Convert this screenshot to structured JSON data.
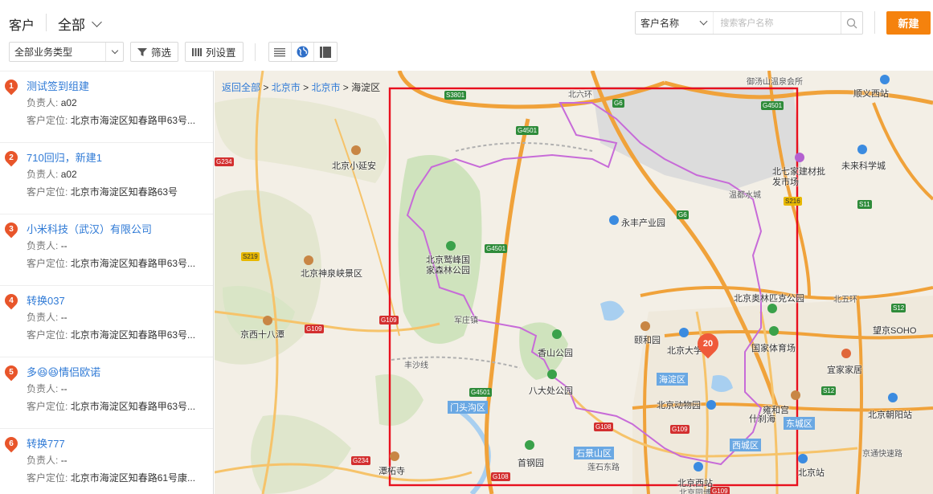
{
  "header": {
    "title": "客户",
    "scope_label": "全部",
    "search_field": "客户名称",
    "search_placeholder": "搜索客户名称",
    "new_button": "新建"
  },
  "toolbar": {
    "business_type": "全部业务类型",
    "filter_label": "筛选",
    "columns_label": "列设置"
  },
  "colors": {
    "accent": "#f5820d",
    "link": "#2f7ad6",
    "pin": "#e8552a",
    "selection": "#e8101e",
    "district_boundary": "#c76bd8"
  },
  "customers": [
    {
      "index": "1",
      "name": "测试签到组建",
      "owner_label": "负责人:",
      "owner": "a02",
      "loc_label": "客户定位:",
      "location": "北京市海淀区知春路甲63号..."
    },
    {
      "index": "2",
      "name": "710回归，新建1",
      "owner_label": "负责人:",
      "owner": "a02",
      "loc_label": "客户定位:",
      "location": "北京市海淀区知春路63号"
    },
    {
      "index": "3",
      "name": "小米科技（武汉）有限公司",
      "owner_label": "负责人:",
      "owner": "--",
      "loc_label": "客户定位:",
      "location": "北京市海淀区知春路甲63号..."
    },
    {
      "index": "4",
      "name": "转换037",
      "owner_label": "负责人:",
      "owner": "--",
      "loc_label": "客户定位:",
      "location": "北京市海淀区知春路甲63号..."
    },
    {
      "index": "5",
      "name": "多😆😆情侣欧诺",
      "owner_label": "负责人:",
      "owner": "--",
      "loc_label": "客户定位:",
      "location": "北京市海淀区知春路甲63号..."
    },
    {
      "index": "6",
      "name": "转换777",
      "owner_label": "负责人:",
      "owner": "--",
      "loc_label": "客户定位:",
      "location": "北京市海淀区知春路61号康..."
    }
  ],
  "map": {
    "breadcrumb": {
      "back": "返回全部",
      "sep": ">",
      "city1": "北京市",
      "city2": "北京市",
      "district": "海淀区"
    },
    "cluster_count": "20",
    "labels": [
      "北京小延安",
      "北京神泉峡景区",
      "京西十八潭",
      "北京鹫峰国家森林公园",
      "永丰产业园",
      "北七家建材批发市场",
      "温都水城",
      "御汤山温泉会所",
      "顺义西站",
      "未来科学城",
      "北京奥林匹克公园",
      "国家体育场",
      "望京SOHO",
      "宜家家居",
      "北京朝阳站",
      "颐和园",
      "北京大学",
      "香山公园",
      "八大处公园",
      "北京动物园",
      "什刹海",
      "雍和宫",
      "首钢园",
      "莲石东路",
      "北京西站",
      "北京站",
      "潭柘寺",
      "军庄镇",
      "丰沙线",
      "北六环",
      "北五环",
      "京通快速路",
      "北京园博园"
    ],
    "districts": [
      "海淀区",
      "门头沟区",
      "石景山区",
      "西城区",
      "东城区"
    ],
    "shields": [
      "S3801",
      "G6",
      "G4501",
      "G4501",
      "G4501",
      "G4501",
      "G6",
      "S216",
      "S11",
      "S12",
      "S12",
      "G109",
      "G109",
      "G108",
      "G109",
      "G108",
      "G234",
      "G234",
      "S219",
      "G109"
    ]
  }
}
